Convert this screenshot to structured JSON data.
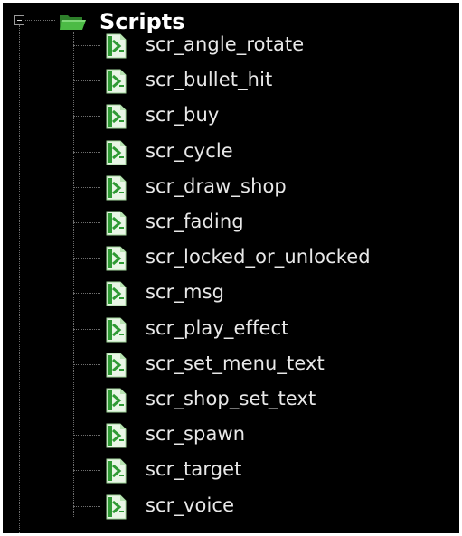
{
  "tree": {
    "root": {
      "label": "Scripts",
      "expanded": true,
      "icon": "folder-open-icon"
    },
    "items": [
      {
        "label": "scr_angle_rotate",
        "icon": "script-icon"
      },
      {
        "label": "scr_bullet_hit",
        "icon": "script-icon"
      },
      {
        "label": "scr_buy",
        "icon": "script-icon"
      },
      {
        "label": "scr_cycle",
        "icon": "script-icon"
      },
      {
        "label": "scr_draw_shop",
        "icon": "script-icon"
      },
      {
        "label": "scr_fading",
        "icon": "script-icon"
      },
      {
        "label": "scr_locked_or_unlocked",
        "icon": "script-icon"
      },
      {
        "label": "scr_msg",
        "icon": "script-icon"
      },
      {
        "label": "scr_play_effect",
        "icon": "script-icon"
      },
      {
        "label": "scr_set_menu_text",
        "icon": "script-icon"
      },
      {
        "label": "scr_shop_set_text",
        "icon": "script-icon"
      },
      {
        "label": "scr_spawn",
        "icon": "script-icon"
      },
      {
        "label": "scr_target",
        "icon": "script-icon"
      },
      {
        "label": "scr_voice",
        "icon": "script-icon"
      }
    ]
  },
  "colors": {
    "background": "#000000",
    "text": "#e8e8e8",
    "folder": "#3fa63a",
    "script_icon": "#2f9a34"
  }
}
